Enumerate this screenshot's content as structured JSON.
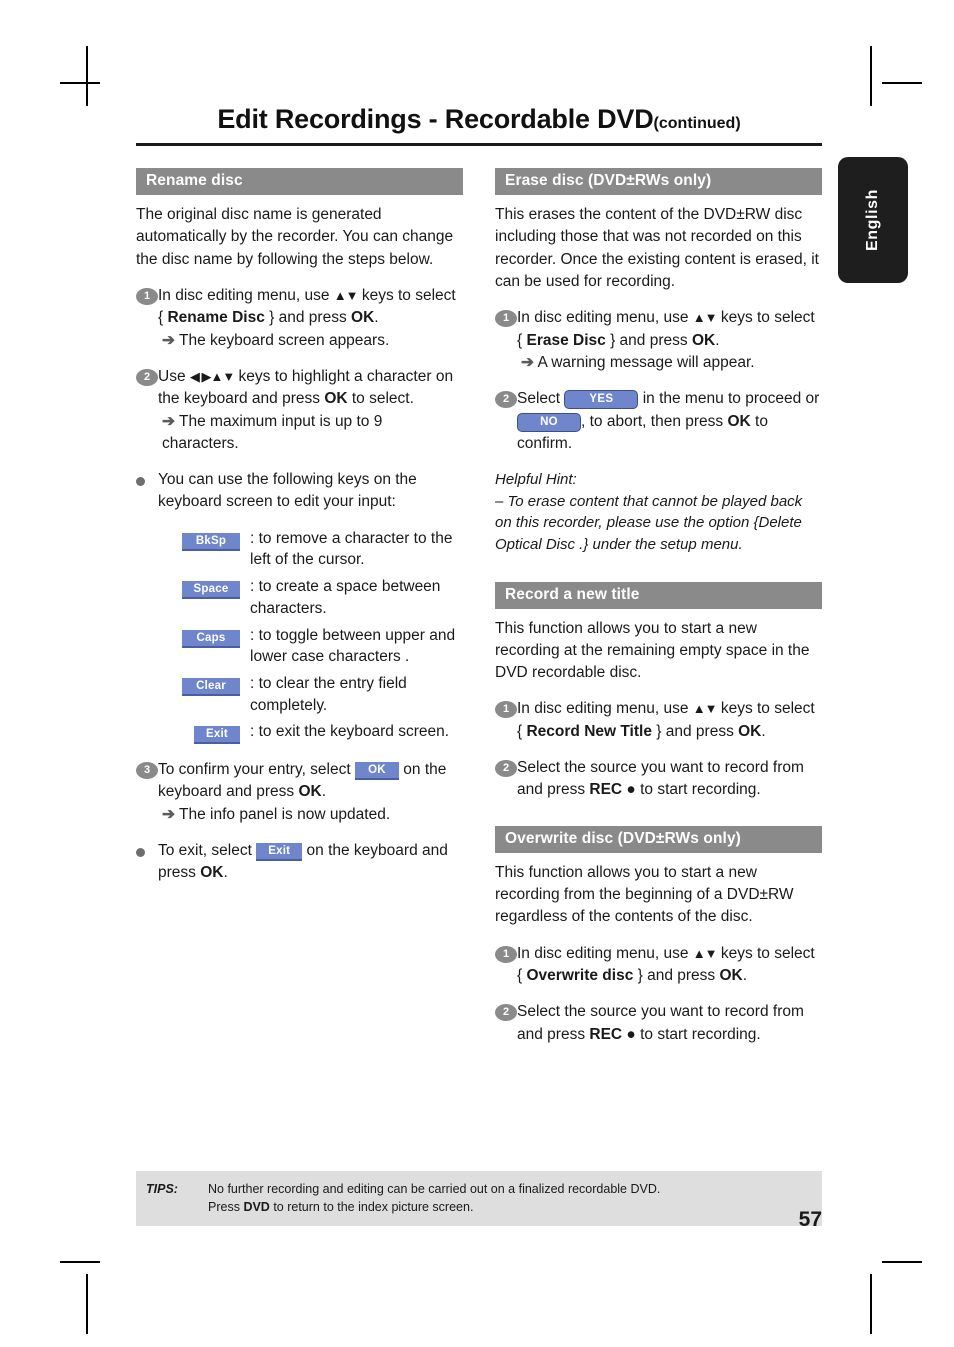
{
  "header": {
    "title": "Edit Recordings - Recordable DVD",
    "continued": "(continued)",
    "language_tab": "English"
  },
  "left_column": {
    "sections": [
      {
        "heading": "Rename disc",
        "intro": "The original disc name is generated automatically by the recorder. You can change the disc name by following the steps below.",
        "steps": [
          {
            "marker": "1",
            "text_a": "In disc editing menu, use ",
            "keys": "▲▼",
            "text_b": " keys to select { ",
            "bold": "Rename Disc",
            "text_c": " } and press ",
            "bold2": "OK",
            "text_d": ".",
            "result": "The keyboard screen appears."
          },
          {
            "marker": "2",
            "text_a": "Use ",
            "keys": "◀ ▶▲▼",
            "text_b": " keys to highlight a character on the keyboard and press ",
            "bold": "OK",
            "text_c": " to select.",
            "result": "The maximum input is up to 9 characters."
          }
        ],
        "bullet_intro": "You can use the following keys on the keyboard screen to edit your input:",
        "key_legend": [
          {
            "key": "BkSp",
            "desc": ": to remove a character to the left of the cursor."
          },
          {
            "key": "Space",
            "desc": ": to create a space between characters."
          },
          {
            "key": "Caps",
            "desc": ": to toggle between upper and lower case characters ."
          },
          {
            "key": "Clear",
            "desc": ": to clear the entry field completely."
          },
          {
            "key": "Exit",
            "desc": ": to exit the keyboard screen."
          }
        ],
        "step3": {
          "marker": "3",
          "text_a": "To confirm your entry, select ",
          "chip": "OK",
          "text_b": " on the keyboard and press ",
          "bold": "OK",
          "text_c": ".",
          "result": "The info panel is now updated."
        },
        "exit_bullet": {
          "text_a": "To exit, select ",
          "chip": "Exit",
          "text_b": " on the keyboard and press ",
          "bold": "OK",
          "text_c": "."
        }
      }
    ]
  },
  "right_column": {
    "sections": [
      {
        "heading": "Erase disc (DVD±RWs only)",
        "intro": "This erases the content of the DVD±RW disc including those that was not recorded on this recorder. Once the existing content is erased, it can be used for recording.",
        "steps": [
          {
            "marker": "1",
            "text_a": "In disc editing menu, use ",
            "keys": "▲▼",
            "text_b": " keys to select { ",
            "bold": "Erase Disc",
            "text_c": " } and press ",
            "bold2": "OK",
            "text_d": ".",
            "result": "A warning message will appear."
          },
          {
            "marker": "2",
            "text_a": "Select ",
            "chip_yes": "YES",
            "text_b": " in the menu to proceed or ",
            "chip_no": "NO",
            "text_c": ", to abort, then press ",
            "bold": "OK",
            "text_d": " to confirm."
          }
        ],
        "hint_label": "Helpful Hint:",
        "hint_text": "–  To erase content that cannot be played back on this recorder, please use the option {Delete Optical Disc .} under the setup menu."
      },
      {
        "heading": "Record a new title",
        "intro": "This function allows you to start a new recording at the remaining empty space in the DVD recordable disc.",
        "steps": [
          {
            "marker": "1",
            "text_a": "In disc editing menu, use ",
            "keys": "▲▼",
            "text_b": " keys to select { ",
            "bold": "Record New Title",
            "text_c": " } and press ",
            "bold2": "OK",
            "text_d": "."
          },
          {
            "marker": "2",
            "text_a": "Select the source you want to record from and press ",
            "bold": "REC ●",
            "text_b": " to start recording."
          }
        ]
      },
      {
        "heading": "Overwrite disc (DVD±RWs only)",
        "intro": "This function allows you to start a new recording from the beginning of a DVD±RW regardless of the contents of the disc.",
        "steps": [
          {
            "marker": "1",
            "text_a": "In disc editing menu, use ",
            "keys": "▲▼",
            "text_b": " keys to select { ",
            "bold": "Overwrite disc",
            "text_c": " } and press ",
            "bold2": "OK",
            "text_d": "."
          },
          {
            "marker": "2",
            "text_a": "Select the source you want to record from and press ",
            "bold": "REC ●",
            "text_b": " to start recording."
          }
        ]
      }
    ]
  },
  "footer": {
    "tips_label": "TIPS:",
    "tips_line1": "No further recording and editing can be carried out on a finalized recordable DVD.",
    "tips_line2_a": "Press ",
    "tips_line2_bold": "DVD",
    "tips_line2_b": " to return to the index picture screen.",
    "page_number": "57"
  }
}
